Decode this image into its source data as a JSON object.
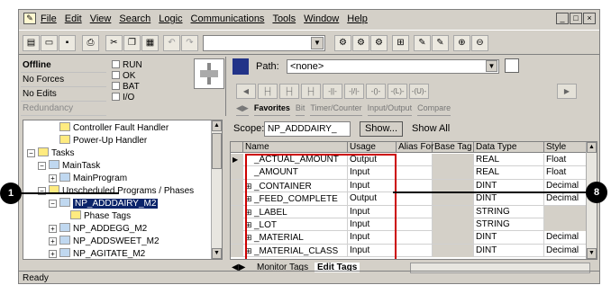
{
  "menubar": {
    "items": [
      "File",
      "Edit",
      "View",
      "Search",
      "Logic",
      "Communications",
      "Tools",
      "Window",
      "Help"
    ],
    "window_buttons": [
      "_",
      "□",
      "×"
    ]
  },
  "toolbar": {
    "combo_value": ""
  },
  "status": {
    "mode": "Offline",
    "forces": "No Forces",
    "edits": "No Edits",
    "redundancy": "Redundancy",
    "checks": [
      "RUN",
      "OK",
      "BAT",
      "I/O"
    ]
  },
  "pathbar": {
    "path_label": "Path:",
    "path_value": "<none>",
    "tabs": [
      "Favorites",
      "Bit",
      "Timer/Counter",
      "Input/Output",
      "Compare"
    ]
  },
  "tree": {
    "items": [
      {
        "label": "Controller Fault Handler",
        "level": 3,
        "type": "folder"
      },
      {
        "label": "Power-Up Handler",
        "level": 3,
        "type": "folder"
      },
      {
        "label": "Tasks",
        "level": 1,
        "type": "folder",
        "pm": "-"
      },
      {
        "label": "MainTask",
        "level": 2,
        "type": "task",
        "pm": "-"
      },
      {
        "label": "MainProgram",
        "level": 3,
        "type": "program",
        "pm": "+"
      },
      {
        "label": "Unscheduled Programs / Phases",
        "level": 2,
        "type": "folder",
        "pm": "-"
      },
      {
        "label": "NP_ADDDAIRY_M2",
        "level": 3,
        "type": "phase",
        "pm": "-",
        "selected": true
      },
      {
        "label": "Phase Tags",
        "level": 4,
        "type": "tags"
      },
      {
        "label": "NP_ADDEGG_M2",
        "level": 3,
        "type": "phase",
        "pm": "+"
      },
      {
        "label": "NP_ADDSWEET_M2",
        "level": 3,
        "type": "phase",
        "pm": "+"
      },
      {
        "label": "NP_AGITATE_M2",
        "level": 3,
        "type": "phase",
        "pm": "+"
      }
    ]
  },
  "scope": {
    "label": "Scope:",
    "value": "NP_ADDDAIRY_",
    "show_button": "Show...",
    "show_value": "Show All"
  },
  "grid": {
    "headers": [
      "Name",
      "Usage",
      "Alias For",
      "Base Tag",
      "Data Type",
      "Style"
    ],
    "rows": [
      {
        "name": "_ACTUAL_AMOUNT",
        "usage": "Output",
        "type": "REAL",
        "style": "Float",
        "pm": ""
      },
      {
        "name": "_AMOUNT",
        "usage": "Input",
        "type": "REAL",
        "style": "Float",
        "pm": ""
      },
      {
        "name": "_CONTAINER",
        "usage": "Input",
        "type": "DINT",
        "style": "Decimal",
        "pm": "+"
      },
      {
        "name": "_FEED_COMPLETE",
        "usage": "Output",
        "type": "DINT",
        "style": "Decimal",
        "pm": "+"
      },
      {
        "name": "_LABEL",
        "usage": "Input",
        "type": "STRING",
        "style": "",
        "pm": "+"
      },
      {
        "name": "_LOT",
        "usage": "Input",
        "type": "STRING",
        "style": "",
        "pm": "+"
      },
      {
        "name": "_MATERIAL",
        "usage": "Input",
        "type": "DINT",
        "style": "Decimal",
        "pm": "+"
      },
      {
        "name": "_MATERIAL_CLASS",
        "usage": "Input",
        "type": "DINT",
        "style": "Decimal",
        "pm": "+"
      }
    ],
    "bottom_tabs": [
      "Monitor Tags",
      "Edit Tags"
    ]
  },
  "statusbar": {
    "text": "Ready"
  },
  "callouts": [
    "1",
    "8"
  ]
}
